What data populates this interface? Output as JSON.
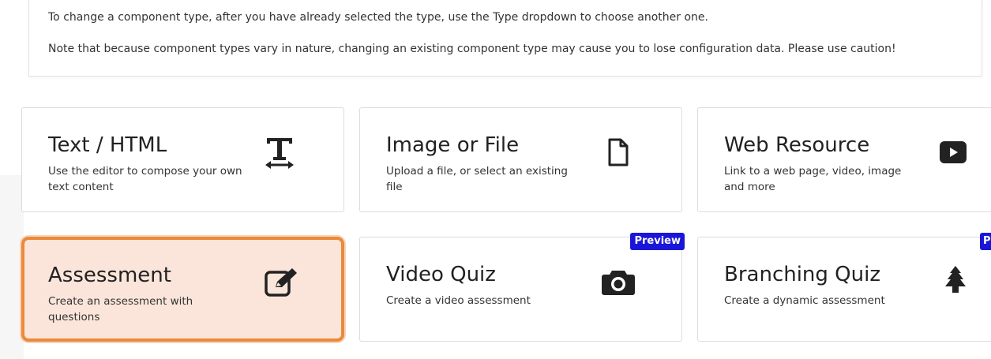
{
  "notice": {
    "line1": "To change a component type, after you have already selected the type, use the Type dropdown to choose another one.",
    "line2": "Note that because component types vary in nature, changing an existing component type may cause you to lose configuration data. Please use caution!"
  },
  "cards": [
    {
      "title": "Text / HTML",
      "desc": "Use the editor to compose your own text content",
      "icon": "text-width-icon"
    },
    {
      "title": "Image or File",
      "desc": "Upload a file, or select an existing file",
      "icon": "file-icon"
    },
    {
      "title": "Web Resource",
      "desc": "Link to a web page, video, image and more",
      "icon": "youtube-play-icon"
    },
    {
      "title": "Assessment",
      "desc": "Create an assessment with questions",
      "icon": "edit-icon",
      "selected": true
    },
    {
      "title": "Video Quiz",
      "desc": "Create a video assessment",
      "icon": "camera-icon",
      "badge": "Preview"
    },
    {
      "title": "Branching Quiz",
      "desc": "Create a dynamic assessment",
      "icon": "tree-icon",
      "badge": "P"
    }
  ],
  "colors": {
    "accent": "#ea8a3a",
    "selected_bg": "#fbe5da",
    "badge": "#1a16d8"
  }
}
